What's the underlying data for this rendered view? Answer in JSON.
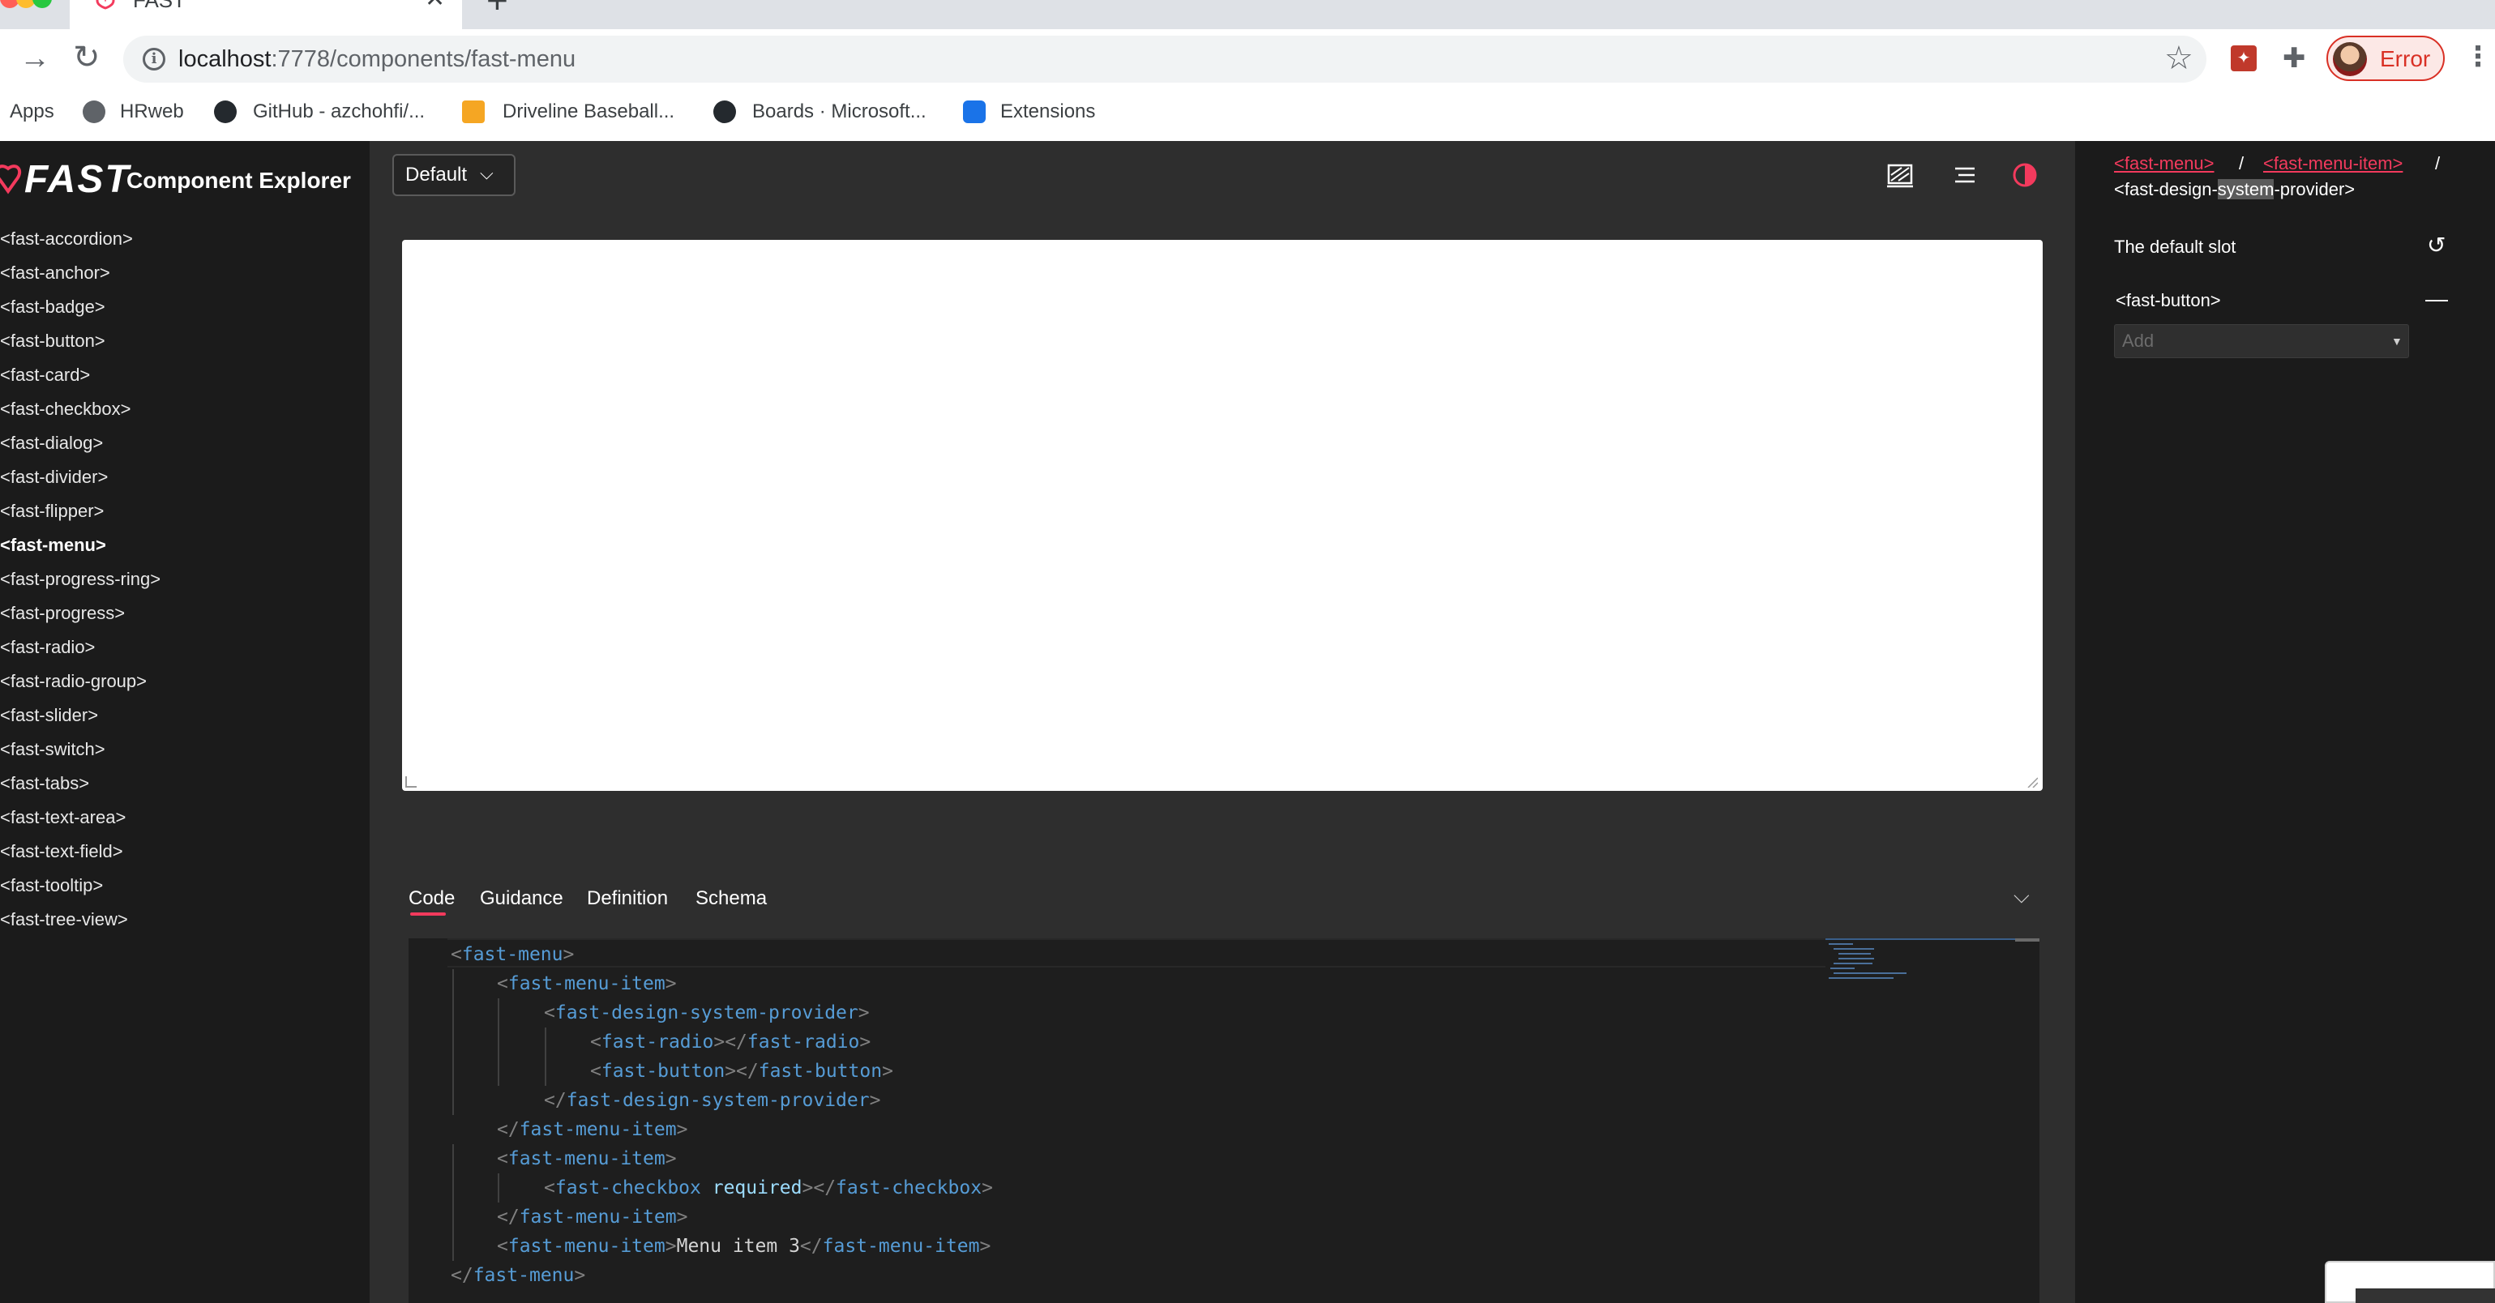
{
  "browser": {
    "tab_title": "FAST",
    "url_host": "localhost",
    "url_path": ":7778/components/fast-menu",
    "profile_label": "Error",
    "bookmarks": [
      "Apps",
      "HRweb",
      "GitHub - azchohfi/...",
      "Driveline Baseball...",
      "Boards · Microsoft...",
      "Extensions"
    ]
  },
  "app": {
    "logo_text": "FAST",
    "title": "Component Explorer",
    "nav": [
      "<fast-accordion>",
      "<fast-anchor>",
      "<fast-badge>",
      "<fast-button>",
      "<fast-card>",
      "<fast-checkbox>",
      "<fast-dialog>",
      "<fast-divider>",
      "<fast-flipper>",
      "<fast-menu>",
      "<fast-progress-ring>",
      "<fast-progress>",
      "<fast-radio>",
      "<fast-radio-group>",
      "<fast-slider>",
      "<fast-switch>",
      "<fast-tabs>",
      "<fast-text-area>",
      "<fast-text-field>",
      "<fast-tooltip>",
      "<fast-tree-view>"
    ],
    "nav_active": "<fast-menu>",
    "theme_select": "Default",
    "dev_tabs": [
      "Code",
      "Guidance",
      "Definition",
      "Schema"
    ],
    "dev_tab_active": "Code"
  },
  "code_lines": [
    [
      "<",
      "fast-menu",
      ">"
    ],
    [
      "<",
      "fast-menu-item",
      ">"
    ],
    [
      "<",
      "fast-design-system-provider",
      ">"
    ],
    [
      "<",
      "fast-radio",
      "></",
      "fast-radio",
      ">"
    ],
    [
      "<",
      "fast-button",
      "></",
      "fast-button",
      ">"
    ],
    [
      "</",
      "fast-design-system-provider",
      ">"
    ],
    [
      "</",
      "fast-menu-item",
      ">"
    ],
    [
      "<",
      "fast-menu-item",
      ">"
    ],
    [
      "<",
      "fast-checkbox",
      " required",
      "></",
      "fast-checkbox",
      ">"
    ],
    [
      "</",
      "fast-menu-item",
      ">"
    ],
    [
      "<",
      "fast-menu-item",
      ">",
      "Menu item 3",
      "</",
      "fast-menu-item",
      ">"
    ],
    [
      "</",
      "fast-menu",
      ">"
    ]
  ],
  "properties": {
    "crumb_1": "<fast-menu>",
    "crumb_2": "<fast-menu-item>",
    "crumb_sep": "/",
    "crumb_3_pre": "<fast-design-",
    "crumb_3_hl": "system",
    "crumb_3_post": "-provider>",
    "slot_label": "The default slot",
    "slot_item": "<fast-button>",
    "add_placeholder": "Add"
  },
  "colors": {
    "accent": "#f33a5d",
    "sidebar_bg": "#1b1b1b",
    "main_bg": "#2e2e2e",
    "editor_bg": "#1e1e1e"
  }
}
